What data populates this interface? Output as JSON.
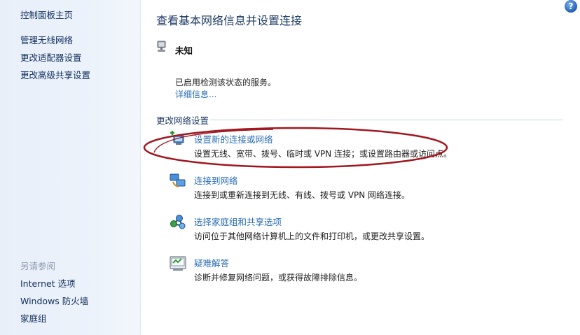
{
  "sidebar": {
    "home": "控制面板主页",
    "links": [
      "管理无线网络",
      "更改适配器设置",
      "更改高级共享设置"
    ],
    "see_also_title": "另请参阅",
    "see_also": [
      "Internet 选项",
      "Windows 防火墙",
      "家庭组"
    ]
  },
  "help_label": "?",
  "main": {
    "title": "查看基本网络信息并设置连接",
    "network_status": "未知",
    "service_text": "已启用检测该状态的服务。",
    "detail_link": "详细信息..."
  },
  "change_settings": {
    "title": "更改网络设置",
    "tasks": [
      {
        "link": "设置新的连接或网络",
        "desc": "设置无线、宽带、拨号、临时或 VPN 连接；或设置路由器或访问点。",
        "icon": "new-connection-icon"
      },
      {
        "link": "连接到网络",
        "desc": "连接到或重新连接到无线、有线、拨号或 VPN 网络连接。",
        "icon": "connect-network-icon"
      },
      {
        "link": "选择家庭组和共享选项",
        "desc": "访问位于其他网络计算机上的文件和打印机，或更改共享设置。",
        "icon": "homegroup-icon"
      },
      {
        "link": "疑难解答",
        "desc": "诊断并修复网络问题，或获得故障排除信息。",
        "icon": "troubleshoot-icon"
      }
    ]
  },
  "colors": {
    "link": "#2a6db5",
    "sidebar_bg": "#edf3fb",
    "annotation_ellipse": "#a01820"
  }
}
